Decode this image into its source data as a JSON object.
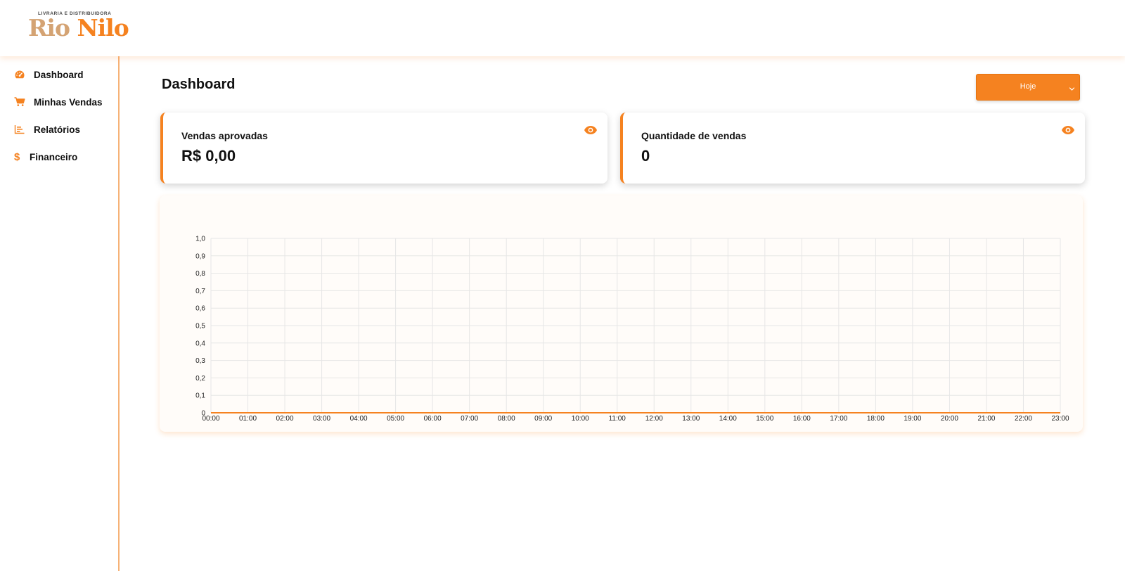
{
  "brand": {
    "subtitle": "LIVRARIA E DISTRIBUIDORA",
    "name_part1": "Rio",
    "name_part2": "Nilo",
    "colors": {
      "primary": "#f58220",
      "secondary": "#d4a373"
    }
  },
  "sidebar": {
    "items": [
      {
        "label": "Dashboard",
        "icon": "speedometer-icon"
      },
      {
        "label": "Minhas Vendas",
        "icon": "cart-icon"
      },
      {
        "label": "Relatórios",
        "icon": "bar-chart-icon"
      },
      {
        "label": "Financeiro",
        "icon": "dollar-icon"
      }
    ]
  },
  "header": {
    "title": "Dashboard",
    "period_select": {
      "value": "Hoje"
    }
  },
  "cards": [
    {
      "label": "Vendas aprovadas",
      "value": "R$ 0,00",
      "icon": "eye-icon"
    },
    {
      "label": "Quantidade de vendas",
      "value": "0",
      "icon": "eye-icon"
    }
  ],
  "chart_data": {
    "type": "line",
    "title": "",
    "xlabel": "",
    "ylabel": "",
    "x": [
      "00:00",
      "01:00",
      "02:00",
      "03:00",
      "04:00",
      "05:00",
      "06:00",
      "07:00",
      "08:00",
      "09:00",
      "10:00",
      "11:00",
      "12:00",
      "13:00",
      "14:00",
      "15:00",
      "16:00",
      "17:00",
      "18:00",
      "19:00",
      "20:00",
      "21:00",
      "22:00",
      "23:00"
    ],
    "series": [
      {
        "values": [
          0,
          0,
          0,
          0,
          0,
          0,
          0,
          0,
          0,
          0,
          0,
          0,
          0,
          0,
          0,
          0,
          0,
          0,
          0,
          0,
          0,
          0,
          0,
          0
        ],
        "color": "#f58220"
      }
    ],
    "yticks": [
      "0",
      "0,1",
      "0,2",
      "0,3",
      "0,4",
      "0,5",
      "0,6",
      "0,7",
      "0,8",
      "0,9",
      "1,0"
    ],
    "ylim": [
      0,
      1
    ],
    "grid": true
  }
}
